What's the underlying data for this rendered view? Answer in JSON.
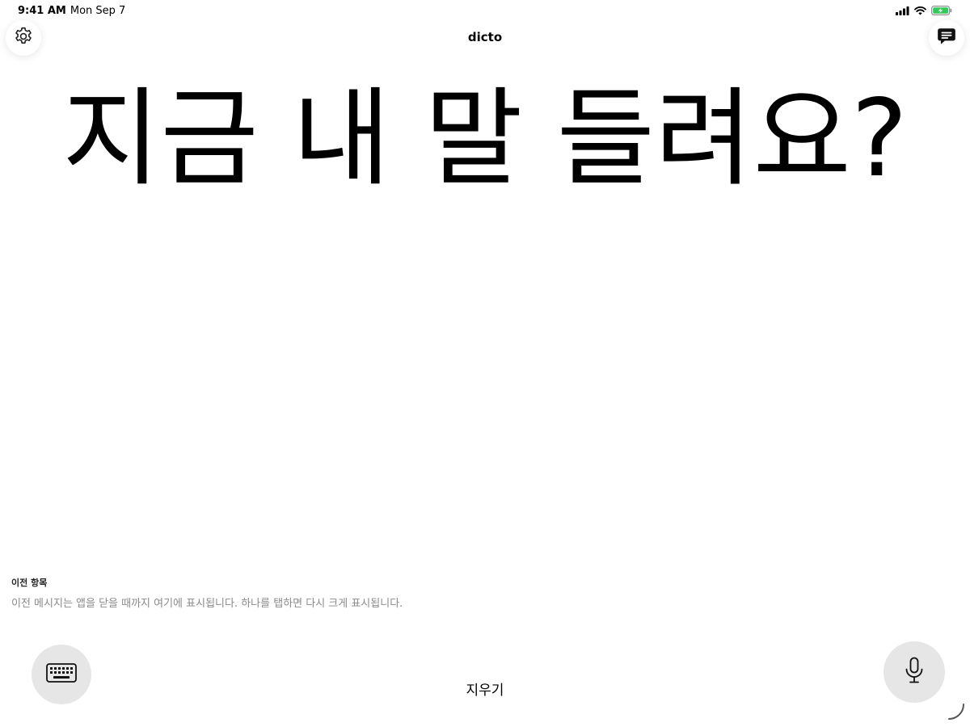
{
  "status_bar": {
    "time": "9:41 AM",
    "date": "Mon Sep 7",
    "battery_color": "#34c759"
  },
  "header": {
    "title": "dicto",
    "settings_icon": "gear-icon",
    "messages_icon": "message-icon"
  },
  "main": {
    "text": "지금 내 말 들려요?"
  },
  "history": {
    "heading": "이전 항목",
    "description": "이전 메시지는 앱을 닫을 때까지 여기에 표시됩니다. 하나를 탭하면 다시 크게 표시됩니다."
  },
  "controls": {
    "keyboard_icon": "keyboard-icon",
    "clear_label": "지우기",
    "mic_icon": "microphone-icon",
    "button_bg": "#e6e6e6"
  }
}
